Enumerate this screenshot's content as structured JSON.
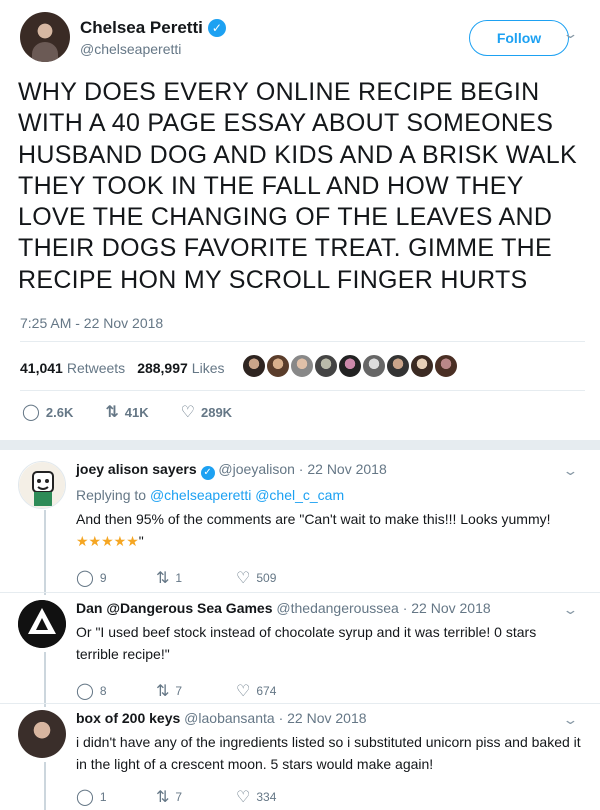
{
  "tweet": {
    "display_name": "Chelsea Peretti",
    "handle": "@chelseaperetti",
    "follow_label": "Follow",
    "text": "WHY DOES EVERY ONLINE RECIPE BEGIN WITH A 40 PAGE ESSAY ABOUT SOMEONES HUSBAND DOG AND KIDS AND A BRISK WALK THEY TOOK IN THE FALL AND HOW THEY LOVE THE CHANGING OF THE LEAVES AND THEIR DOGS FAVORITE TREAT. GIMME THE RECIPE HON MY SCROLL FINGER HURTS",
    "timestamp": "7:25 AM - 22 Nov 2018",
    "retweets_count": "41,041",
    "retweets_label": "Retweets",
    "likes_count": "288,997",
    "likes_label": "Likes",
    "replies_short": "2.6K",
    "retweets_short": "41K",
    "likes_short": "289K"
  },
  "replies": [
    {
      "name": "joey alison sayers",
      "verified": true,
      "handle": "@joeyalison",
      "date": "22 Nov 2018",
      "replying_label": "Replying to",
      "replying_to": "@chelseaperetti @chel_c_cam",
      "text": "And then 95% of the comments are \"Can't wait to make this!!! Looks yummy!",
      "text_tail": "\"",
      "stars": "★★★★★",
      "reply_count": "9",
      "retweet_count": "1",
      "like_count": "509"
    },
    {
      "name": "Dan @Dangerous Sea Games",
      "handle": "@thedangeroussea",
      "date": "22 Nov 2018",
      "text": "Or \"I used beef stock instead of chocolate syrup and it was terrible! 0 stars terrible recipe!\"",
      "reply_count": "8",
      "retweet_count": "7",
      "like_count": "674"
    },
    {
      "name": "box of 200 keys",
      "handle": "@laobansanta",
      "date": "22 Nov 2018",
      "text": "i didn't have any of the ingredients listed so i substituted unicorn piss and baked it in the light of a crescent moon. 5 stars would make again!",
      "reply_count": "1",
      "retweet_count": "7",
      "like_count": "334"
    }
  ],
  "icons": {
    "verified": "✓",
    "reply": "◯",
    "retweet": "⇅",
    "like": "♡",
    "more": "⌄"
  }
}
